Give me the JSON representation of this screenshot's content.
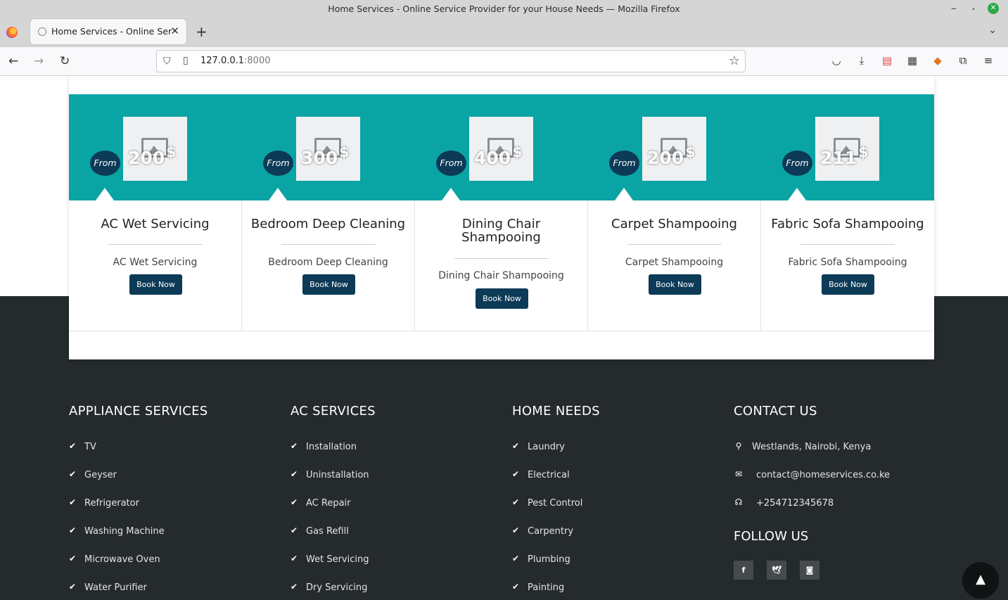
{
  "browser": {
    "window_title": "Home Services - Online Service Provider for your House Needs — Mozilla Firefox",
    "tab_title": "Home Services - Online Service Provider for your House Needs",
    "url_host": "127.0.0.1",
    "url_port": ":8000"
  },
  "services": [
    {
      "from": "From",
      "price": "200",
      "currency": "$",
      "name": "AC Wet Servicing",
      "description": "AC Wet Servicing",
      "button": "Book Now"
    },
    {
      "from": "From",
      "price": "300",
      "currency": "$",
      "name": "Bedroom Deep Cleaning",
      "description": "Bedroom Deep Cleaning",
      "button": "Book Now"
    },
    {
      "from": "From",
      "price": "400",
      "currency": "$",
      "name": "Dining Chair Shampooing",
      "description": "Dining Chair Shampooing",
      "button": "Book Now"
    },
    {
      "from": "From",
      "price": "200",
      "currency": "$",
      "name": "Carpet Shampooing",
      "description": "Carpet Shampooing",
      "button": "Book Now"
    },
    {
      "from": "From",
      "price": "211",
      "currency": "$",
      "name": "Fabric Sofa Shampooing",
      "description": "Fabric Sofa Shampooing",
      "button": "Book Now"
    }
  ],
  "footer": {
    "appliance": {
      "heading": "APPLIANCE SERVICES",
      "items": [
        "TV",
        "Geyser",
        "Refrigerator",
        "Washing Machine",
        "Microwave Oven",
        "Water Purifier"
      ]
    },
    "ac": {
      "heading": "AC SERVICES",
      "items": [
        "Installation",
        "Uninstallation",
        "AC Repair",
        "Gas Refill",
        "Wet Servicing",
        "Dry Servicing"
      ]
    },
    "home": {
      "heading": "HOME NEEDS",
      "items": [
        "Laundry",
        "Electrical",
        "Pest Control",
        "Carpentry",
        "Plumbing",
        "Painting"
      ]
    },
    "contact": {
      "heading": "CONTACT US",
      "address": "Westlands, Nairobi, Kenya",
      "email": "contact@homeservices.co.ke",
      "phone": "+254712345678",
      "follow_heading": "FOLLOW US",
      "social": [
        "f",
        "t",
        "ig"
      ]
    }
  },
  "colors": {
    "teal_band": "#0ba4a4",
    "navy": "#0c3a57",
    "footer_bg": "#252a2c"
  }
}
